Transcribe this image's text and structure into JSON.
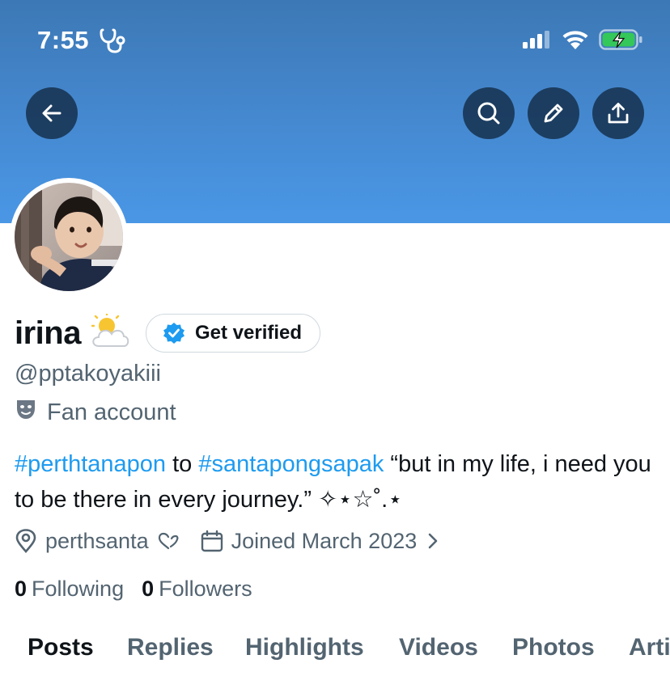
{
  "status_bar": {
    "time": "7:55",
    "time_glyph_icon": "stethoscope-icon",
    "signal_icon": "cellular-signal-icon",
    "wifi_icon": "wifi-icon",
    "battery_icon": "battery-charging-icon",
    "battery_color": "#34c759"
  },
  "header": {
    "back_icon": "arrow-left-icon",
    "search_icon": "search-icon",
    "edit_icon": "pencil-icon",
    "share_icon": "share-upload-icon",
    "banner_color": "#4a97e6"
  },
  "profile": {
    "display_name": "irina",
    "name_emoji": "sun-behind-cloud",
    "verify_button_label": "Get verified",
    "verified_badge_color": "#1d9bf0",
    "handle": "@pptakoyakiii",
    "category_icon": "performing-arts-masks-icon",
    "category": "Fan account",
    "bio": {
      "hashtag1": "#perthtanapon",
      "connector": " to ",
      "hashtag2": "#santapongsapak",
      "text": " “but in my life, i need you to be there in every journey.” ✧⋆☆˚.⋆"
    },
    "location_icon": "location-pin-icon",
    "location": "perthsanta",
    "location_suffix_icon": "heart-outline-icon",
    "joined_icon": "calendar-icon",
    "joined": "Joined March 2023",
    "joined_chevron_icon": "chevron-right-icon",
    "following_count": "0",
    "following_label": "Following",
    "followers_count": "0",
    "followers_label": "Followers"
  },
  "tabs": [
    {
      "label": "Posts",
      "active": true
    },
    {
      "label": "Replies",
      "active": false
    },
    {
      "label": "Highlights",
      "active": false
    },
    {
      "label": "Videos",
      "active": false
    },
    {
      "label": "Photos",
      "active": false
    },
    {
      "label": "Articles",
      "active": false
    }
  ],
  "colors": {
    "link": "#1d9bf0",
    "secondary_text": "#536471",
    "primary_text": "#0f1419"
  }
}
